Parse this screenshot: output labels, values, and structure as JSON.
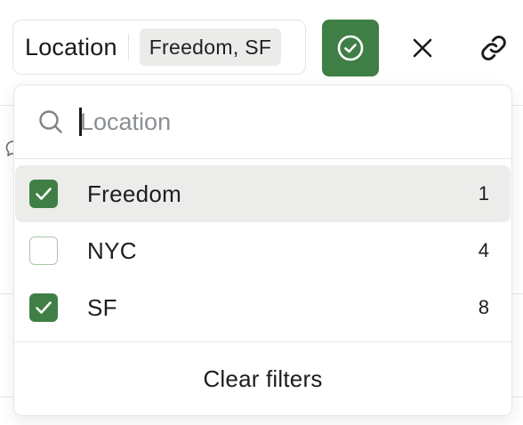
{
  "filter": {
    "label": "Location",
    "value": "Freedom, SF"
  },
  "actions": {
    "confirm_icon": "check-circle-icon",
    "close_icon": "close-icon",
    "link_icon": "link-icon"
  },
  "search": {
    "placeholder": "Location",
    "value": ""
  },
  "options": [
    {
      "label": "Freedom",
      "count": "1",
      "checked": true,
      "highlighted": true
    },
    {
      "label": "NYC",
      "count": "4",
      "checked": false,
      "highlighted": false
    },
    {
      "label": "SF",
      "count": "8",
      "checked": true,
      "highlighted": false
    }
  ],
  "footer": {
    "clear_label": "Clear filters"
  },
  "colors": {
    "accent": "#3f7f45",
    "highlight": "#ecedeb",
    "chip": "#ebecea",
    "unchecked_border": "#a9c7a9"
  }
}
